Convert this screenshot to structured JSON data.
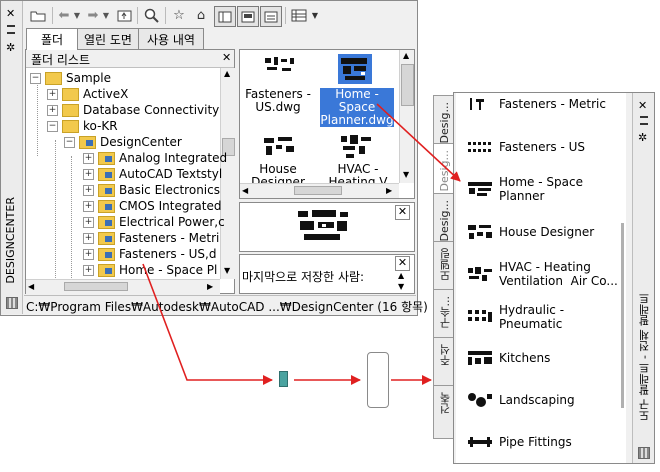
{
  "designcenter": {
    "title": "DESIGNCENTER",
    "tabs": [
      "폴더",
      "열린 도면",
      "사용 내역"
    ],
    "tree": {
      "header": "폴더 리스트",
      "items": [
        {
          "label": "Sample",
          "level": 0
        },
        {
          "label": "ActiveX",
          "level": 1
        },
        {
          "label": "Database Connectivity",
          "level": 1
        },
        {
          "label": "ko-KR",
          "level": 1
        },
        {
          "label": "DesignCenter",
          "level": 2
        },
        {
          "label": "Analog Integrated",
          "level": 3
        },
        {
          "label": "AutoCAD Textstyl",
          "level": 3
        },
        {
          "label": "Basic Electronics",
          "level": 3
        },
        {
          "label": "CMOS Integrated",
          "level": 3
        },
        {
          "label": "Electrical Power,c",
          "level": 3
        },
        {
          "label": "Fasteners - Metri",
          "level": 3
        },
        {
          "label": "Fasteners - US,d",
          "level": 3
        },
        {
          "label": "Home - Space Pl",
          "level": 3
        }
      ]
    },
    "content_items": [
      {
        "label": "Fasteners -\nUS.dwg",
        "selected": false
      },
      {
        "label": "Home -\nSpace\nPlanner.dwg",
        "selected": true
      },
      {
        "label": "House\nDesigner",
        "selected": false
      },
      {
        "label": "HVAC -\nHeating V",
        "selected": false
      }
    ],
    "description": "마지막으로 저장한 사람:",
    "status_path": "C:₩Program Files₩Autodesk₩AutoCAD ...₩DesignCenter (16 항목)",
    "close_glyph": "✕"
  },
  "tool_palette": {
    "title": "도구 팔레트 - 전체 팔레트",
    "side_tabs": [
      "Desig...",
      "Desig...",
      "Desig...",
      "모델링",
      "구속...",
      "주석",
      "건축"
    ],
    "items": [
      "Fasteners - Metric",
      "Fasteners - US",
      "Home - Space\nPlanner",
      "House Designer",
      "HVAC - Heating\nVentilation  Air Co...",
      "Hydraulic -\nPneumatic",
      "Kitchens",
      "Landscaping",
      "Pipe Fittings"
    ]
  },
  "colors": {
    "arrow": "#e02020",
    "selection": "#3a78d8",
    "folder": "#f2c94c"
  }
}
